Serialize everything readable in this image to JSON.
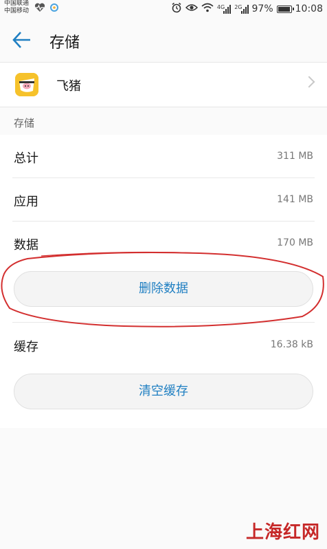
{
  "status_bar": {
    "carrier_1": "中国联通",
    "carrier_2": "中国移动",
    "net_type_1": "4G",
    "net_type_2": "2G",
    "battery": "97%",
    "time": "10:08"
  },
  "app_bar": {
    "title": "存储"
  },
  "app": {
    "name": "飞猪"
  },
  "storage_section": {
    "label": "存储",
    "rows": [
      {
        "label": "总计",
        "value": "311 MB"
      },
      {
        "label": "应用",
        "value": "141 MB"
      },
      {
        "label": "数据",
        "value": "170 MB"
      }
    ],
    "delete_button": "删除数据"
  },
  "cache": {
    "label": "缓存",
    "value": "16.38 kB",
    "clear_button": "清空缓存"
  },
  "watermark": "上海红网",
  "colors": {
    "accent": "#1f7fc2",
    "annotation": "#d32f2f",
    "app_icon": "#f6c22b"
  }
}
